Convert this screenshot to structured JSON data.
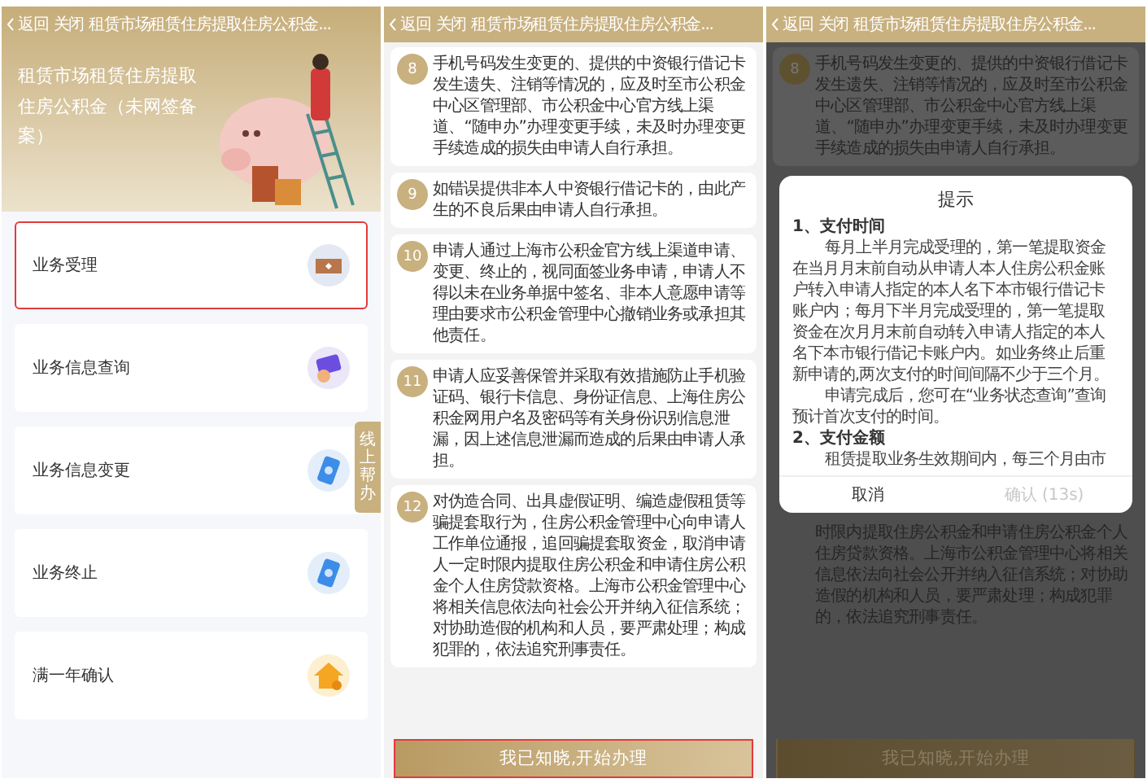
{
  "panels": [
    {
      "kind": "menu",
      "header": {
        "back": "返回",
        "close": "关闭",
        "title": "租赁市场租赁住房提取住房公积金..."
      },
      "hero_title": "租赁市场租赁住房提取住房公积金（未网签备案）",
      "side_tab": "线上帮办",
      "menu": [
        {
          "label": "业务受理",
          "highlighted": true
        },
        {
          "label": "业务信息查询",
          "highlighted": false
        },
        {
          "label": "业务信息变更",
          "highlighted": false
        },
        {
          "label": "业务终止",
          "highlighted": false
        },
        {
          "label": "满一年确认",
          "highlighted": false
        }
      ]
    },
    {
      "kind": "steps",
      "header": {
        "back": "返回",
        "close": "关闭",
        "title": "租赁市场租赁住房提取住房公积金..."
      },
      "steps": [
        {
          "number": "8",
          "text": "手机号码发生变更的、提供的中资银行借记卡发生遗失、注销等情况的，应及时至市公积金中心区管理部、市公积金中心官方线上渠道、“随申办”办理变更手续，未及时办理变更手续造成的损失由申请人自行承担。"
        },
        {
          "number": "9",
          "text": "如错误提供非本人中资银行借记卡的，由此产生的不良后果由申请人自行承担。"
        },
        {
          "number": "10",
          "text": "申请人通过上海市公积金官方线上渠道申请、变更、终止的，视同面签业务申请，申请人不得以未在业务单据中签名、非本人意愿申请等理由要求市公积金管理中心撤销业务或承担其他责任。"
        },
        {
          "number": "11",
          "text": "申请人应妥善保管并采取有效措施防止手机验证码、银行卡信息、身份证信息、上海住房公积金网用户名及密码等有关身份识别信息泄漏，因上述信息泄漏而造成的后果由申请人承担。"
        },
        {
          "number": "12",
          "text": "对伪造合同、出具虚假证明、编造虚假租赁等骗提套取行为，住房公积金管理中心向申请人工作单位通报，追回骗提套取资金，取消申请人一定时限内提取住房公积金和申请住房公积金个人住房贷款资格。上海市公积金管理中心将相关信息依法向社会公开并纳入征信系统；对协助造假的机构和人员，要严肃处理；构成犯罪的，依法追究刑事责任。"
        }
      ],
      "button": {
        "label": "我已知晓,开始办理",
        "highlighted": true
      }
    },
    {
      "kind": "dialog",
      "header": {
        "back": "返回",
        "close": "关闭",
        "title": "租赁市场租赁住房提取住房公积金..."
      },
      "steps": [
        {
          "number": "8",
          "text": "手机号码发生变更的、提供的中资银行借记卡发生遗失、注销等情况的，应及时至市公积金中心区管理部、市公积金中心官方线上渠道、“随申办”办理变更手续，未及时办理变更手续造成的损失由申请人自行承担。"
        }
      ],
      "dialog": {
        "title": "提示",
        "sections": [
          {
            "heading": "1、支付时间",
            "paragraphs": [
              "每月上半月完成受理的，第一笔提取资金在当月月末前自动从申请人本人住房公积金账户转入申请人指定的本人名下本市银行借记卡账户内；每月下半月完成受理的，第一笔提取资金在次月月末前自动转入申请人指定的本人名下本市银行借记卡账户内。如业务终止后重新申请的,两次支付的时间间隔不少于三个月。",
              "申请完成后，您可在“业务状态查询”查询预计首次支付的时间。"
            ]
          },
          {
            "heading": "2、支付金额",
            "paragraphs": [
              "租赁提取业务生效期间内，每三个月由市"
            ]
          }
        ],
        "buttons": [
          {
            "label": "取消",
            "disabled": false
          },
          {
            "label": "确认 (13s)",
            "disabled": true
          }
        ]
      },
      "background_text": "时限内提取住房公积金和申请住房公积金个人住房贷款资格。上海市公积金管理中心将相关信息依法向社会公开并纳入征信系统；对协助造假的机构和人员，要严肃处理；构成犯罪的，依法追究刑事责任。",
      "button": {
        "label": "我已知晓,开始办理",
        "highlighted": false
      }
    }
  ]
}
